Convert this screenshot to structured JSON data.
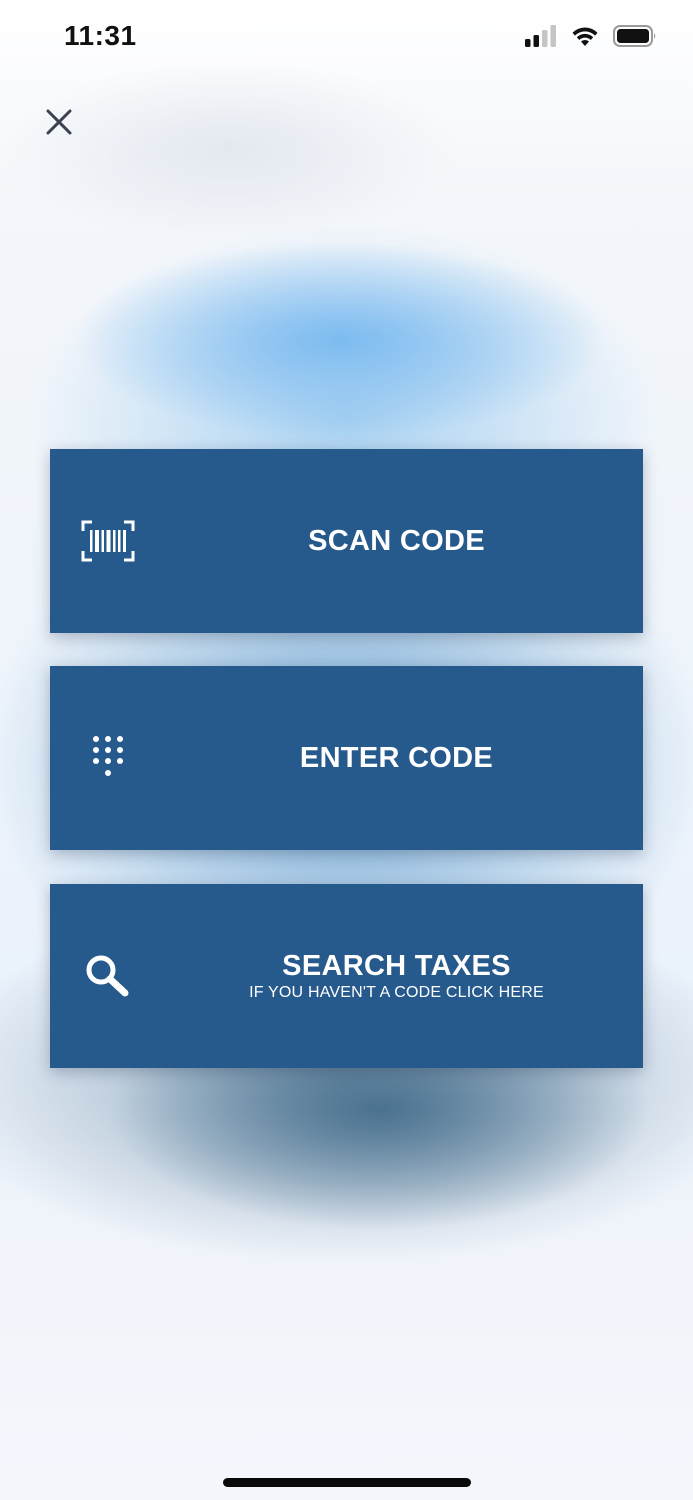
{
  "status_bar": {
    "time": "11:31",
    "icons": [
      "signal-icon",
      "wifi-icon",
      "battery-icon"
    ]
  },
  "header": {
    "close_icon": "close-icon"
  },
  "actions": [
    {
      "title": "SCAN CODE",
      "subtitle": "",
      "icon": "barcode-icon"
    },
    {
      "title": "ENTER CODE",
      "subtitle": "",
      "icon": "dialpad-icon"
    },
    {
      "title": "SEARCH TAXES",
      "subtitle": "IF YOU HAVEN'T A CODE CLICK HERE",
      "icon": "search-icon"
    }
  ],
  "colors": {
    "card_background": "#265a8c",
    "card_text": "#ffffff",
    "close_icon": "#3a4150"
  }
}
